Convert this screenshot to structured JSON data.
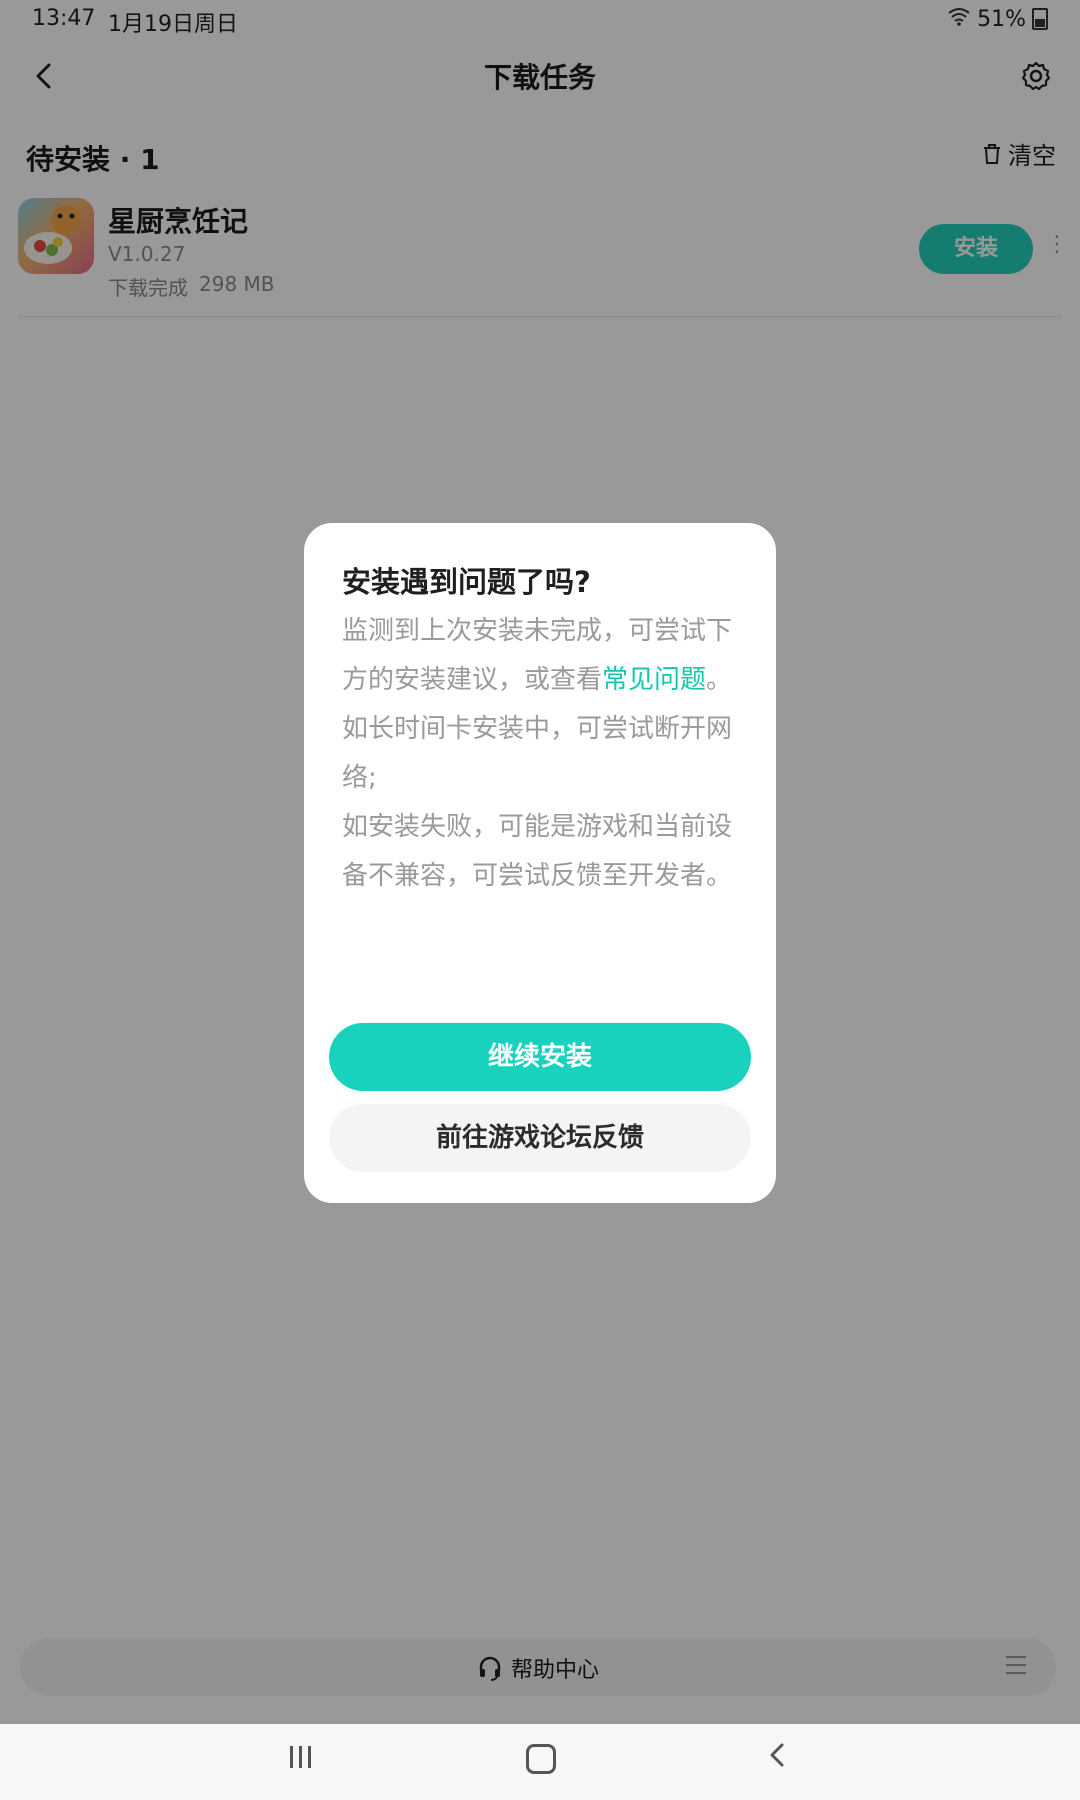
{
  "status_bar": {
    "time": "13:47",
    "date": "1月19日周日",
    "battery": "51%"
  },
  "header": {
    "title": "下载任务"
  },
  "section": {
    "title": "待安装 · 1",
    "clear_label": "清空"
  },
  "task": {
    "name": "星厨烹饪记",
    "version": "V1.0.27",
    "status": "下载完成",
    "size": "298 MB",
    "install_label": "安装",
    "more_label": "⋮"
  },
  "bottom_bar": {
    "help_label": "帮助中心"
  },
  "dialog": {
    "title": "安装遇到问题了吗?",
    "para1_prefix": "监测到上次安装未完成，可尝试下方的安装建议，或查看",
    "para1_link": "常见问题",
    "para1_suffix": "。",
    "para2": "如长时间卡安装中，可尝试断开网络;",
    "para3": "如安装失败，可能是游戏和当前设备不兼容，可尝试反馈至开发者。",
    "continue_label": "继续安装",
    "forum_label": "前往游戏论坛反馈"
  },
  "colors": {
    "accent": "#18d2bd",
    "link": "#14c7b0",
    "overlay": "rgba(0,0,0,0.40)"
  }
}
